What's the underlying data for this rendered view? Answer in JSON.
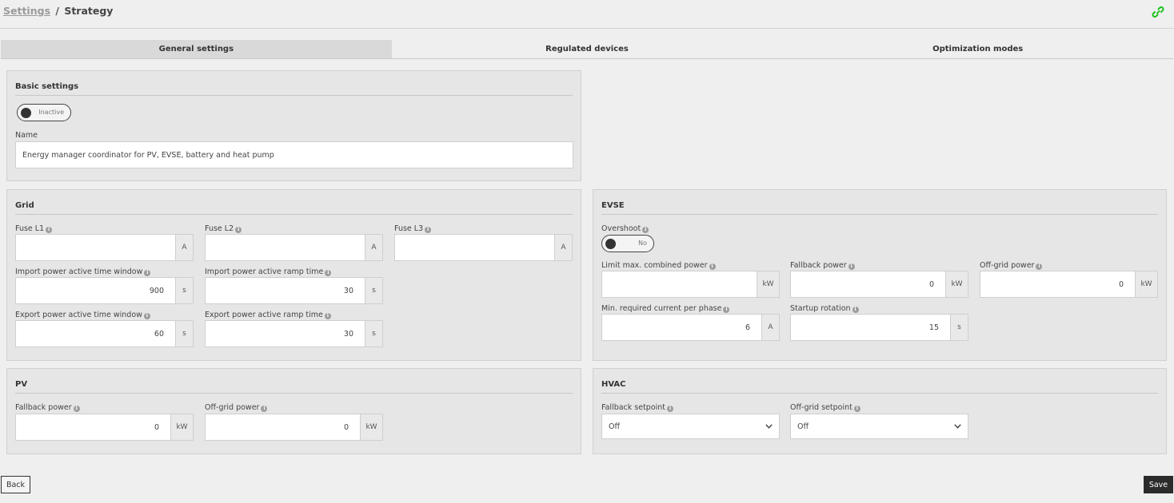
{
  "breadcrumb": {
    "parent": "Settings",
    "separator": "/",
    "current": "Strategy"
  },
  "colors": {
    "link_icon": "#1ec31e",
    "active_tab": "#d9d9d9",
    "panel_bg": "#e6e6e6",
    "save_button": "#2b2b2b"
  },
  "tabs": [
    {
      "label": "General settings",
      "active": true
    },
    {
      "label": "Regulated devices",
      "active": false
    },
    {
      "label": "Optimization modes",
      "active": false
    }
  ],
  "basic": {
    "title": "Basic settings",
    "toggle_label": "Inactive",
    "name_label": "Name",
    "name_value": "Energy manager coordinator for PV, EVSE, battery and heat pump"
  },
  "grid": {
    "title": "Grid",
    "fuse_l1": {
      "label": "Fuse L1",
      "value": "",
      "unit": "A"
    },
    "fuse_l2": {
      "label": "Fuse L2",
      "value": "",
      "unit": "A"
    },
    "fuse_l3": {
      "label": "Fuse L3",
      "value": "",
      "unit": "A"
    },
    "import_window": {
      "label": "Import power active time window",
      "value": "900",
      "unit": "s"
    },
    "import_ramp": {
      "label": "Import power active ramp time",
      "value": "30",
      "unit": "s"
    },
    "export_window": {
      "label": "Export power active time window",
      "value": "60",
      "unit": "s"
    },
    "export_ramp": {
      "label": "Export power active ramp time",
      "value": "30",
      "unit": "s"
    }
  },
  "evse": {
    "title": "EVSE",
    "overshoot_label": "Overshoot",
    "overshoot_toggle": "No",
    "limit_power": {
      "label": "Limit max. combined power",
      "value": "",
      "unit": "kW"
    },
    "fallback_power": {
      "label": "Fallback power",
      "value": "0",
      "unit": "kW"
    },
    "offgrid_power": {
      "label": "Off-grid power",
      "value": "0",
      "unit": "kW"
    },
    "min_current": {
      "label": "Min. required current per phase",
      "value": "6",
      "unit": "A"
    },
    "startup_rotation": {
      "label": "Startup rotation",
      "value": "15",
      "unit": "s"
    }
  },
  "pv": {
    "title": "PV",
    "fallback_power": {
      "label": "Fallback power",
      "value": "0",
      "unit": "kW"
    },
    "offgrid_power": {
      "label": "Off-grid power",
      "value": "0",
      "unit": "kW"
    }
  },
  "hvac": {
    "title": "HVAC",
    "fallback_setpoint": {
      "label": "Fallback setpoint",
      "value": "Off"
    },
    "offgrid_setpoint": {
      "label": "Off-grid setpoint",
      "value": "Off"
    }
  },
  "buttons": {
    "back": "Back",
    "save": "Save"
  }
}
